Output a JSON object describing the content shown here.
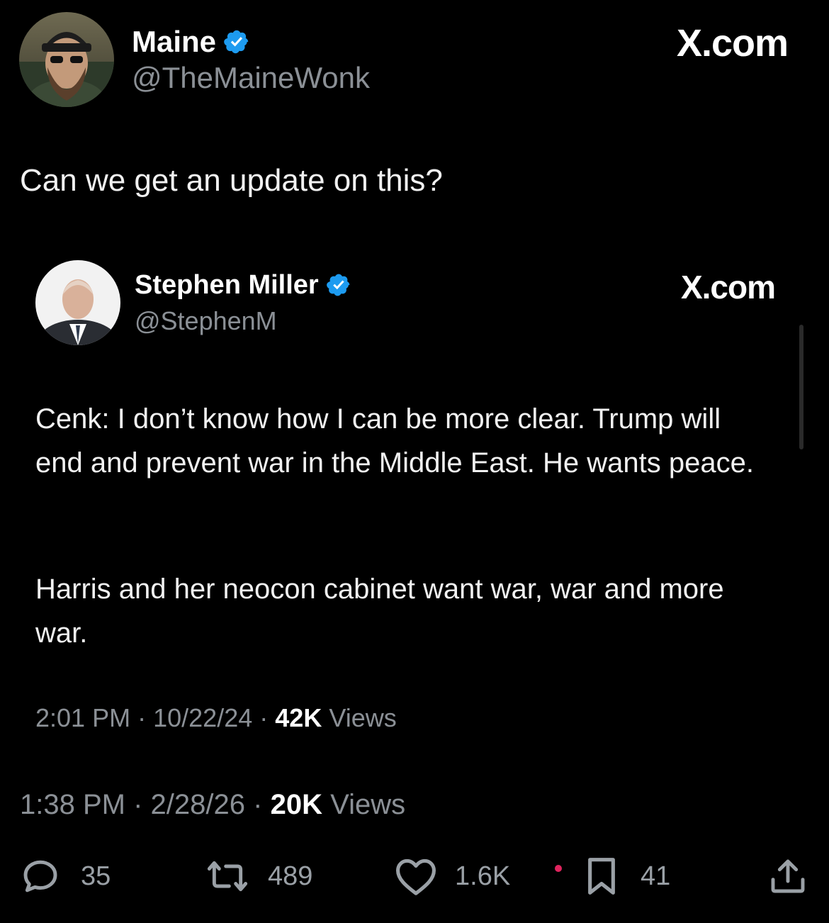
{
  "outer_tweet": {
    "display_name": "Maine",
    "handle": "@TheMaineWonk",
    "brand": "X.com",
    "text": "Can we get an update on this?",
    "time": "1:38 PM",
    "date": "2/28/26",
    "views_count": "20K",
    "views_label": "Views",
    "separator": "·"
  },
  "quoted_tweet": {
    "display_name": "Stephen Miller",
    "handle": "@StephenM",
    "brand": "X.com",
    "paragraph_1": "Cenk: I don’t know how I can be more clear. Trump will end and prevent war in the Middle East. He wants peace.",
    "paragraph_2": "Harris and her neocon cabinet want war, war and more war.",
    "time": "2:01 PM",
    "date": "10/22/24",
    "views_count": "42K",
    "views_label": "Views",
    "separator": "·"
  },
  "actions": {
    "replies": "35",
    "reposts": "489",
    "likes": "1.6K",
    "bookmarks": "41"
  },
  "icons": {
    "reply": "reply-icon",
    "repost": "repost-icon",
    "like": "heart-icon",
    "bookmark": "bookmark-icon",
    "share": "share-icon",
    "verified": "verified-badge-icon"
  },
  "colors": {
    "background": "#000000",
    "verified": "#1d9bf0",
    "muted_text": "#8b9096",
    "notification_dot": "#e0245e"
  }
}
